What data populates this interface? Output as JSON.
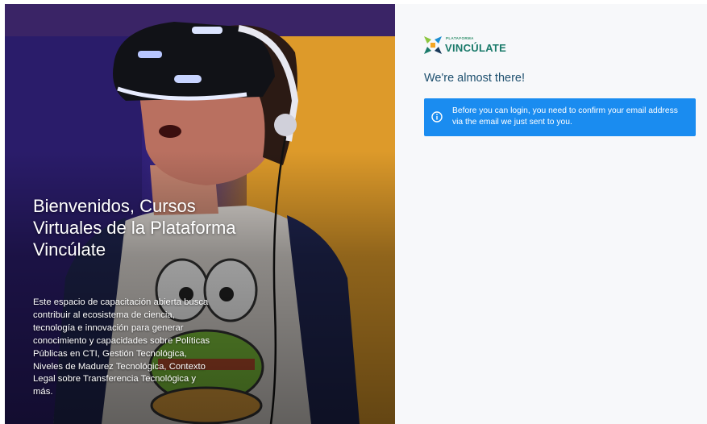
{
  "hero": {
    "title": "Bienvenidos, Cursos Virtuales de la Plataforma Vincúlate",
    "description": "Este espacio de capacitación abierta busca contribuir al ecosistema de ciencia, tecnología e innovación para generar conocimiento y capacidades sobre Políticas Públicas en CTI, Gestión Tecnológica, Niveles de Madurez Tecnológica, Contexto Legal sobre Transferencia Tecnológica y más."
  },
  "logo": {
    "small_text": "PLATAFORMA",
    "brand_text": "VINCÚLATE",
    "icon": "vinculate-arrows-logo"
  },
  "main": {
    "headline": "We're almost there!",
    "alert": {
      "icon": "info-circle-icon",
      "message": "Before you can login, you need to confirm your email address via the email we just sent to you.",
      "color": "#1a8cf0"
    }
  },
  "colors": {
    "brand_green": "#1a7a6a",
    "headline": "#1d4f6e",
    "alert_bg": "#1a8cf0"
  }
}
